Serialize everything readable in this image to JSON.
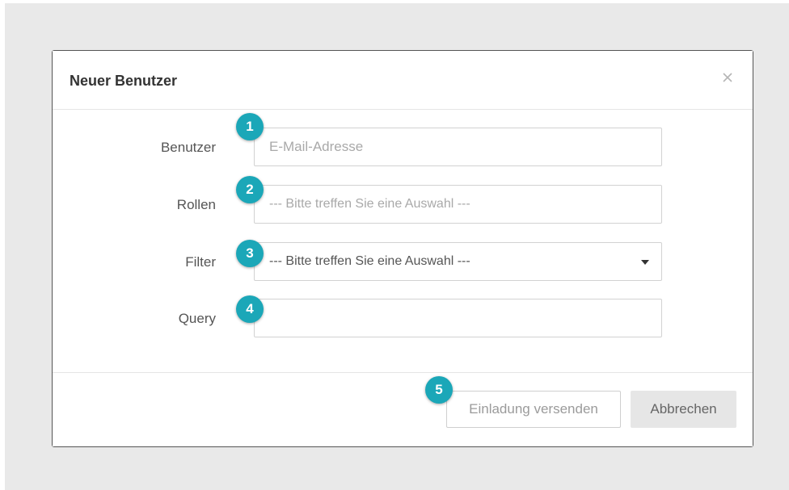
{
  "modal": {
    "title": "Neuer Benutzer",
    "close_icon": "close-icon"
  },
  "form": {
    "user": {
      "label": "Benutzer",
      "placeholder": "E-Mail-Adresse",
      "value": ""
    },
    "roles": {
      "label": "Rollen",
      "placeholder": "--- Bitte treffen Sie eine Auswahl ---"
    },
    "filter": {
      "label": "Filter",
      "selected": "--- Bitte treffen Sie eine Auswahl ---",
      "icon": "caret-down-icon"
    },
    "query": {
      "label": "Query",
      "value": ""
    }
  },
  "footer": {
    "invite_label": "Einladung versenden",
    "cancel_label": "Abbrechen"
  },
  "annotations": {
    "badge_1": "1",
    "badge_2": "2",
    "badge_3": "3",
    "badge_4": "4",
    "badge_5": "5",
    "badge_color": "#1ba7b8"
  },
  "colors": {
    "backdrop": "#e9e9e9",
    "modal_background": "#ffffff"
  }
}
